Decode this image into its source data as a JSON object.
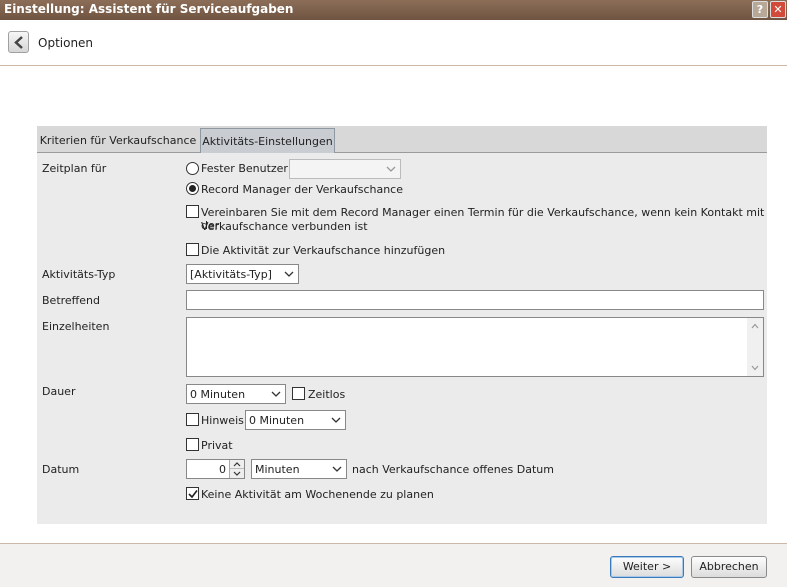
{
  "window": {
    "title": "Einstellung: Assistent für Serviceaufgaben",
    "help_glyph": "?",
    "close_glyph": "✕"
  },
  "header": {
    "title": "Optionen"
  },
  "tabs": [
    {
      "label": "Kriterien für Verkaufschance",
      "active": false
    },
    {
      "label": "Aktivitäts-Einstellungen",
      "active": true
    }
  ],
  "form": {
    "zeitplan_label": "Zeitplan für",
    "fester_benutzer_label": "Fester Benutzer",
    "fester_benutzer_value": "",
    "record_manager_label": "Record Manager der Verkaufschance",
    "vereinbaren_line1": "Vereinbaren Sie mit dem Record Manager einen Termin für die Verkaufschance, wenn kein Kontakt mit der",
    "vereinbaren_line2": "Verkaufschance verbunden ist",
    "aktivitaet_hinzufuegen_label": "Die Aktivität zur Verkaufschance hinzufügen",
    "aktivitaets_typ_label": "Aktivitäts-Typ",
    "aktivitaets_typ_value": "[Aktivitäts-Typ]",
    "betreffend_label": "Betreffend",
    "betreffend_value": "",
    "einzelheiten_label": "Einzelheiten",
    "einzelheiten_value": "",
    "dauer_label": "Dauer",
    "dauer_value": "0 Minuten",
    "zeitlos_label": "Zeitlos",
    "hinweis_label": "Hinweis",
    "hinweis_value": "0 Minuten",
    "privat_label": "Privat",
    "datum_label": "Datum",
    "datum_number": "0",
    "datum_unit": "Minuten",
    "datum_suffix": "nach Verkaufschance offenes Datum",
    "wochenende_label": "Keine Aktivität am Wochenende zu planen"
  },
  "state": {
    "fester_benutzer_selected": false,
    "record_manager_selected": true,
    "vereinbaren_checked": false,
    "aktivitaet_hinzufuegen_checked": false,
    "zeitlos_checked": false,
    "hinweis_checked": false,
    "privat_checked": false,
    "wochenende_checked": true
  },
  "footer": {
    "next_label": "Weiter >",
    "cancel_label": "Abbrechen"
  },
  "colors": {
    "titlebar": "#7d6350",
    "panel": "#ebebeb",
    "active_tab": "#c9cdd2"
  },
  "icons": [
    "back-arrow-icon",
    "help-icon",
    "close-icon",
    "chevron-down-icon",
    "check-icon",
    "scroll-up-icon",
    "scroll-down-icon",
    "spin-up-icon",
    "spin-down-icon"
  ]
}
